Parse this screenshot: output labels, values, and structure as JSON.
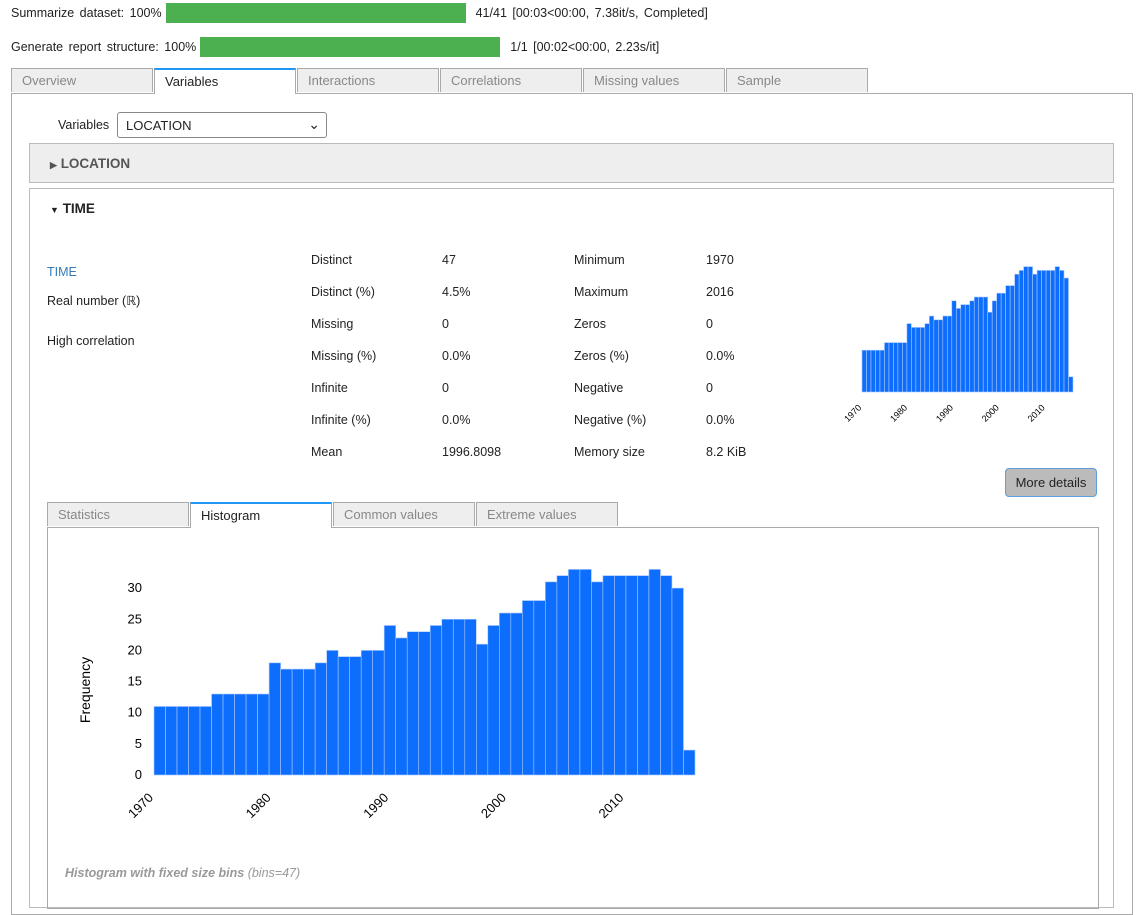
{
  "progress": [
    {
      "label": "Summarize  dataset:  100%",
      "status": "41/41  [00:03<00:00,    7.38it/s,  Completed]",
      "percent": 100
    },
    {
      "label": "Generate  report  structure:  100%",
      "status": "1/1  [00:02<00:00,    2.23s/it]",
      "percent": 100
    }
  ],
  "tabs": [
    "Overview",
    "Variables",
    "Interactions",
    "Correlations",
    "Missing values",
    "Sample"
  ],
  "variables_label": "Variables",
  "selected_variable": "LOCATION",
  "location_header": "LOCATION",
  "time_header": "TIME",
  "var": {
    "name": "TIME",
    "type": "Real number (ℝ)",
    "warning": "High correlation"
  },
  "stats_left": [
    [
      "Distinct",
      "47"
    ],
    [
      "Distinct (%)",
      "4.5%"
    ],
    [
      "Missing",
      "0"
    ],
    [
      "Missing (%)",
      "0.0%"
    ],
    [
      "Infinite",
      "0"
    ],
    [
      "Infinite (%)",
      "0.0%"
    ],
    [
      "Mean",
      "1996.8098"
    ]
  ],
  "stats_right": [
    [
      "Minimum",
      "1970"
    ],
    [
      "Maximum",
      "2016"
    ],
    [
      "Zeros",
      "0"
    ],
    [
      "Zeros (%)",
      "0.0%"
    ],
    [
      "Negative",
      "0"
    ],
    [
      "Negative (%)",
      "0.0%"
    ],
    [
      "Memory size",
      "8.2 KiB"
    ]
  ],
  "more_details": "More details",
  "subtabs": [
    "Statistics",
    "Histogram",
    "Common values",
    "Extreme values"
  ],
  "caption": "Histogram with fixed size bins",
  "caption_note": "(bins=47)",
  "chart_data": {
    "type": "bar",
    "title": "",
    "xlabel": "",
    "ylabel": "Frequency",
    "xlim": [
      1970,
      2016
    ],
    "ylim": [
      0,
      34
    ],
    "yticks": [
      0,
      5,
      10,
      15,
      20,
      25,
      30
    ],
    "xticks": [
      1970,
      1980,
      1990,
      2000,
      2010
    ],
    "bins": 47,
    "color": "#0d6efd",
    "values": [
      11,
      11,
      11,
      11,
      11,
      13,
      13,
      13,
      13,
      13,
      18,
      17,
      17,
      17,
      18,
      20,
      19,
      19,
      20,
      20,
      24,
      22,
      23,
      23,
      24,
      25,
      25,
      25,
      21,
      24,
      26,
      26,
      28,
      28,
      31,
      32,
      33,
      33,
      31,
      32,
      32,
      32,
      32,
      33,
      32,
      30,
      4
    ]
  }
}
